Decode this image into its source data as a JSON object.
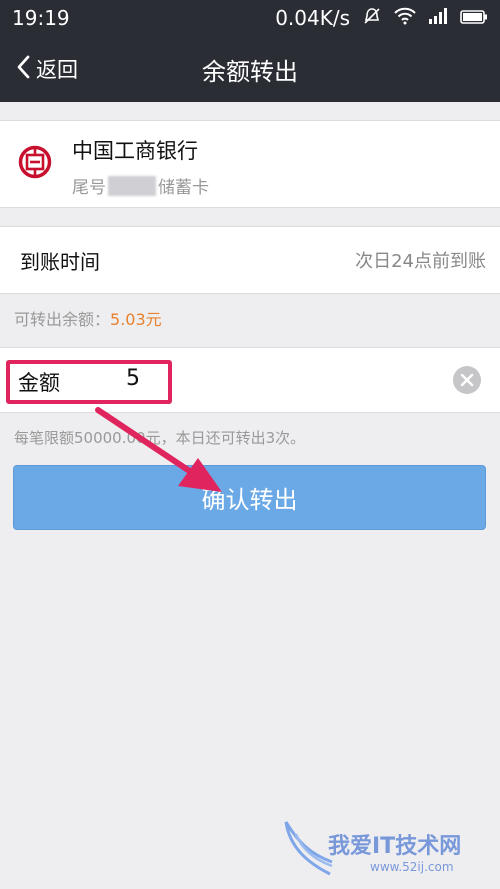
{
  "status_bar": {
    "time": "19:19",
    "network_speed": "0.04K/s",
    "icons": [
      "mute-icon",
      "wifi-icon",
      "signal-icon",
      "battery-icon"
    ]
  },
  "nav": {
    "back_label": "返回",
    "title": "余额转出"
  },
  "bank": {
    "name": "中国工商银行",
    "tail_prefix": "尾号",
    "card_type": "储蓄卡",
    "logo_color": "#c8102e"
  },
  "arrival": {
    "label": "到账时间",
    "value": "次日24点前到账"
  },
  "balance": {
    "prefix": "可转出余额：",
    "amount": "5.03元"
  },
  "amount_field": {
    "label": "金额",
    "value": "5"
  },
  "limit_note": "每笔限额50000.00元，本日还可转出3次。",
  "confirm_button": {
    "label": "确认转出",
    "color": "#6aa9e6"
  },
  "annotation": {
    "highlight_color": "#e0245e"
  },
  "watermark": {
    "main": "我爱IT技术网",
    "sub": "www.52ij.com"
  }
}
